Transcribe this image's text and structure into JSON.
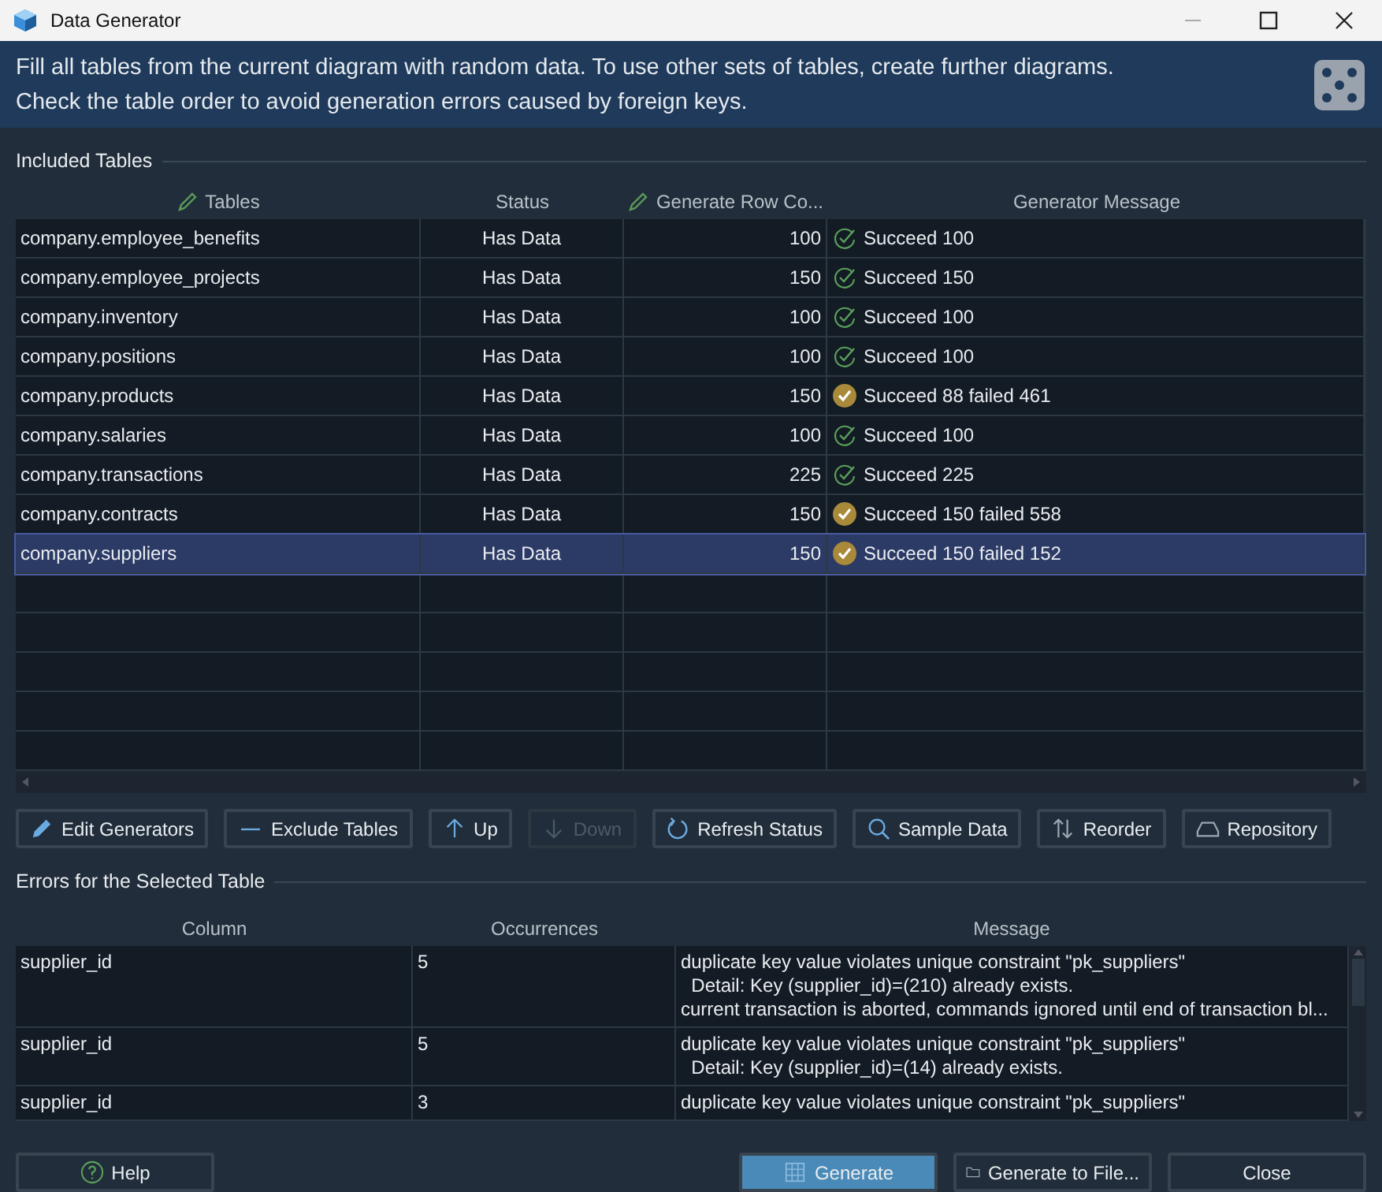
{
  "window": {
    "title": "Data Generator"
  },
  "banner": {
    "lines": [
      "Fill all tables from the current diagram with random data. To use other sets of tables, create further diagrams.",
      "Check the table order to avoid generation errors caused by foreign keys."
    ]
  },
  "included": {
    "title": "Included Tables",
    "columns": [
      {
        "label": "Tables",
        "editable": true
      },
      {
        "label": "Status",
        "editable": false
      },
      {
        "label": "Generate Row Co...",
        "editable": true
      },
      {
        "label": "Generator Message",
        "editable": false
      }
    ],
    "rows": [
      {
        "table": "company.employee_benefits",
        "status": "Has Data",
        "count": "100",
        "has_failures": false,
        "message": "Succeed 100",
        "selected": false
      },
      {
        "table": "company.employee_projects",
        "status": "Has Data",
        "count": "150",
        "has_failures": false,
        "message": "Succeed 150",
        "selected": false
      },
      {
        "table": "company.inventory",
        "status": "Has Data",
        "count": "100",
        "has_failures": false,
        "message": "Succeed 100",
        "selected": false
      },
      {
        "table": "company.positions",
        "status": "Has Data",
        "count": "100",
        "has_failures": false,
        "message": "Succeed 100",
        "selected": false
      },
      {
        "table": "company.products",
        "status": "Has Data",
        "count": "150",
        "has_failures": true,
        "message": "Succeed 88 failed 461",
        "selected": false
      },
      {
        "table": "company.salaries",
        "status": "Has Data",
        "count": "100",
        "has_failures": false,
        "message": "Succeed 100",
        "selected": false
      },
      {
        "table": "company.transactions",
        "status": "Has Data",
        "count": "225",
        "has_failures": false,
        "message": "Succeed 225",
        "selected": false
      },
      {
        "table": "company.contracts",
        "status": "Has Data",
        "count": "150",
        "has_failures": true,
        "message": "Succeed 150 failed 558",
        "selected": false
      },
      {
        "table": "company.suppliers",
        "status": "Has Data",
        "count": "150",
        "has_failures": true,
        "message": "Succeed 150 failed 152",
        "selected": true
      }
    ]
  },
  "toolbar": [
    {
      "kind": "pencil",
      "label": "Edit Generators",
      "disabled": false
    },
    {
      "kind": "minus",
      "label": "Exclude Tables",
      "disabled": false
    },
    {
      "kind": "up",
      "label": "Up",
      "disabled": false
    },
    {
      "kind": "down",
      "label": "Down",
      "disabled": true
    },
    {
      "kind": "refresh",
      "label": "Refresh Status",
      "disabled": false
    },
    {
      "kind": "search",
      "label": "Sample Data",
      "disabled": false
    },
    {
      "kind": "reorder",
      "label": "Reorder",
      "disabled": false
    },
    {
      "kind": "drive",
      "label": "Repository",
      "disabled": false
    }
  ],
  "errors": {
    "title": "Errors for the Selected Table",
    "columns": [
      "Column",
      "Occurrences",
      "Message"
    ],
    "rows": [
      {
        "column": "supplier_id",
        "occurrences": "5",
        "message": [
          "duplicate key value violates unique constraint \"pk_suppliers\"",
          "  Detail: Key (supplier_id)=(210) already exists.",
          "current transaction is aborted, commands ignored until end of transaction bl..."
        ]
      },
      {
        "column": "supplier_id",
        "occurrences": "5",
        "message": [
          "duplicate key value violates unique constraint \"pk_suppliers\"",
          "  Detail: Key (supplier_id)=(14) already exists."
        ]
      },
      {
        "column": "supplier_id",
        "occurrences": "3",
        "message": [
          "duplicate key value violates unique constraint \"pk_suppliers\""
        ]
      }
    ]
  },
  "footer": [
    {
      "kind": "help",
      "label": "Help",
      "primary": false
    },
    {
      "kind": "generate",
      "label": "Generate",
      "primary": true
    },
    {
      "kind": "folder",
      "label": "Generate to File...",
      "primary": false
    },
    {
      "kind": "close",
      "label": "Close",
      "primary": false
    }
  ]
}
